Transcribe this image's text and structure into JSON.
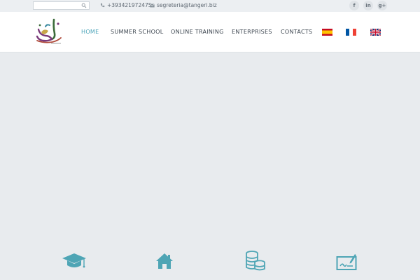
{
  "topbar": {
    "search": {
      "value": "",
      "placeholder": ""
    },
    "phone": "+393421972475",
    "email": "segreteria@tangeri.biz",
    "social": [
      {
        "name": "facebook",
        "glyph": "f"
      },
      {
        "name": "linkedin",
        "glyph": "in"
      },
      {
        "name": "google-plus",
        "glyph": "g+"
      }
    ]
  },
  "nav": {
    "items": [
      {
        "label": "HOME",
        "active": true
      },
      {
        "label": "SUMMER SCHOOL",
        "active": false
      },
      {
        "label": "ONLINE TRAINING",
        "active": false
      },
      {
        "label": "ENTERPRISES",
        "active": false
      },
      {
        "label": "CONTACTS",
        "active": false
      }
    ],
    "flags": [
      "spanish-flag-icon",
      "french-flag-icon",
      "uk-flag-icon"
    ]
  },
  "features": {
    "icons": [
      "graduation-cap-icon",
      "home-icon",
      "coins-icon",
      "certificate-icon"
    ]
  },
  "colors": {
    "accent": "#4aa3b8",
    "icon_teal": "#4ea5b5",
    "page_bg": "#e8ebee",
    "topbar_bg": "#eceff2"
  }
}
